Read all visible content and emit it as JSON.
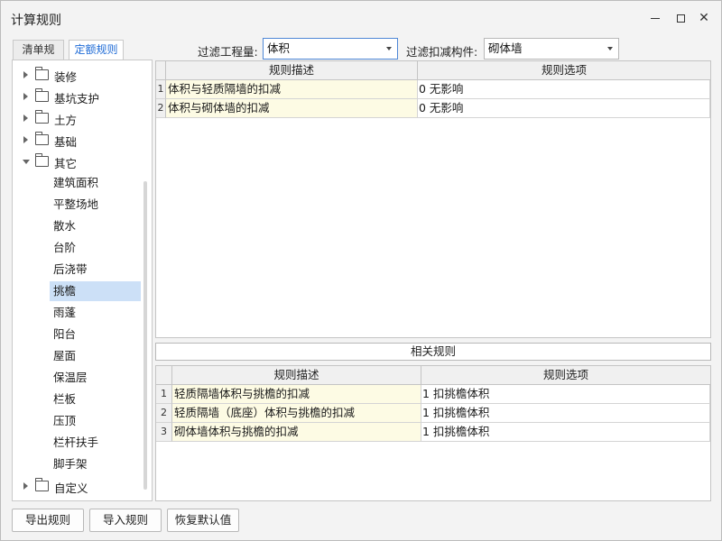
{
  "window": {
    "title": "计算规则"
  },
  "tabs": [
    {
      "label": "清单规则"
    },
    {
      "label": "定额规则"
    }
  ],
  "filters": {
    "quantity_label": "过滤工程量:",
    "quantity_value": "体积",
    "component_label": "过滤扣减构件:",
    "component_value": "砌体墙"
  },
  "tree": {
    "folders_top": [
      {
        "label": "装修",
        "expanded": false
      },
      {
        "label": "基坑支护",
        "expanded": false
      },
      {
        "label": "土方",
        "expanded": false
      },
      {
        "label": "基础",
        "expanded": false
      },
      {
        "label": "其它",
        "expanded": true
      }
    ],
    "leaves": [
      "建筑面积",
      "平整场地",
      "散水",
      "台阶",
      "后浇带",
      "挑檐",
      "雨蓬",
      "阳台",
      "屋面",
      "保温层",
      "栏板",
      "压顶",
      "栏杆扶手",
      "脚手架"
    ],
    "selected": "挑檐",
    "folders_bottom": [
      {
        "label": "自定义",
        "expanded": false
      }
    ]
  },
  "main_table": {
    "headers": [
      "规则描述",
      "规则选项"
    ],
    "rows": [
      {
        "num": "1",
        "desc": "体积与轻质隔墙的扣减",
        "opt": "0  无影响"
      },
      {
        "num": "2",
        "desc": "体积与砌体墙的扣减",
        "opt": "0  无影响"
      }
    ]
  },
  "related": {
    "title": "相关规则",
    "headers": [
      "规则描述",
      "规则选项"
    ],
    "rows": [
      {
        "num": "1",
        "desc": "轻质隔墙体积与挑檐的扣减",
        "opt": "1  扣挑檐体积"
      },
      {
        "num": "2",
        "desc": "轻质隔墙（底座）体积与挑檐的扣减",
        "opt": "1  扣挑檐体积"
      },
      {
        "num": "3",
        "desc": "砌体墙体积与挑檐的扣减",
        "opt": "1  扣挑檐体积"
      }
    ]
  },
  "buttons": {
    "export": "导出规则",
    "import": "导入规则",
    "reset": "恢复默认值"
  }
}
